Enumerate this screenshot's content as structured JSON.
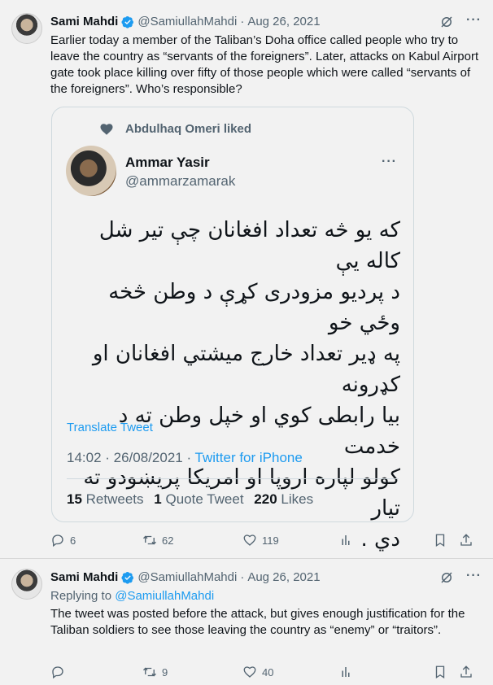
{
  "tweet1": {
    "name": "Sami Mahdi",
    "handle": "@SamiullahMahdi",
    "sep": "·",
    "date": "Aug 26, 2021",
    "text": "Earlier today a member of the Taliban’s Doha office called people who try to leave the country as “servants of the foreigners”.  Later, attacks on Kabul Airport gate took place killing over fifty of those people which were called “servants of the foreigners”. Who’s responsible?",
    "quoted": {
      "liked_by": "Abdulhaq Omeri liked",
      "name": "Ammar Yasir",
      "handle": "@ammarzamarak",
      "lines": [
        "که یو څه تعداد افغانان چې تیر شل کاله یې",
        "د پردیو مزودری کړې د وطن څخه وځي  خو",
        "په ډیر تعداد خارج میشتي افغانان او کډرونه",
        "بیا رابطی کوي او خپل وطن ته د خدمت",
        "کولو لپاره اروپا او امریکا پریښودو ته تیار",
        "دي ."
      ],
      "translate": "Translate Tweet",
      "time": "14:02 · 26/08/2021 · ",
      "source": "Twitter for iPhone",
      "retweets_count": "15",
      "retweets_label": "Retweets",
      "quotes_count": "1",
      "quotes_label": "Quote Tweet",
      "likes_count": "220",
      "likes_label": "Likes"
    },
    "actions": {
      "replies": "6",
      "retweets": "62",
      "likes": "119"
    }
  },
  "tweet2": {
    "name": "Sami Mahdi",
    "handle": "@SamiullahMahdi",
    "sep": "·",
    "date": "Aug 26, 2021",
    "replying_label": "Replying to",
    "replying_to": "@SamiullahMahdi",
    "text": "The tweet was posted before the attack, but gives enough justification for the Taliban soldiers to see those leaving the country as “enemy” or “traitors”.",
    "actions": {
      "replies": "",
      "retweets": "9",
      "likes": "40"
    }
  },
  "colors": {
    "accent": "#1d9bf0",
    "muted": "#536471",
    "text": "#0f1419",
    "background": "#f2f2f2"
  }
}
